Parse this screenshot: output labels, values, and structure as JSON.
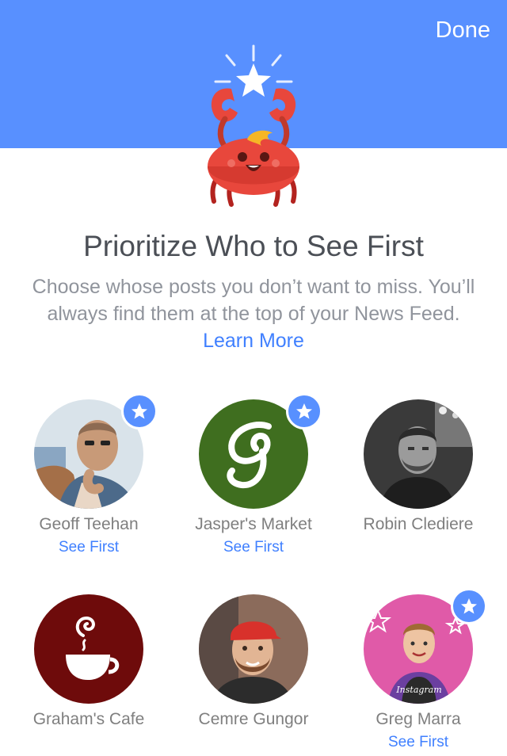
{
  "header": {
    "done_label": "Done",
    "background": "#5890ff",
    "mascot_icon": "crab-holding-star-icon"
  },
  "intro": {
    "title": "Prioritize Who to See First",
    "subtitle": "Choose whose posts you don’t want to miss. You’ll always find them at the top of your News Feed.",
    "learn_more": "Learn More"
  },
  "people": [
    {
      "name": "Geoff Teehan",
      "status": "See First",
      "selected": true
    },
    {
      "name": "Jasper's Market",
      "status": "See First",
      "selected": true
    },
    {
      "name": "Robin Clediere",
      "status": "",
      "selected": false
    },
    {
      "name": "Graham's Cafe",
      "status": "",
      "selected": false
    },
    {
      "name": "Cemre Gungor",
      "status": "",
      "selected": false
    },
    {
      "name": "Greg Marra",
      "status": "See First",
      "selected": true
    }
  ],
  "colors": {
    "accent": "#4080ff",
    "badge": "#5890ff",
    "title": "#4b4f56",
    "subtitle": "#90949c",
    "jaspers_bg": "#3f6e1f",
    "grahams_bg": "#6e0b0b"
  }
}
